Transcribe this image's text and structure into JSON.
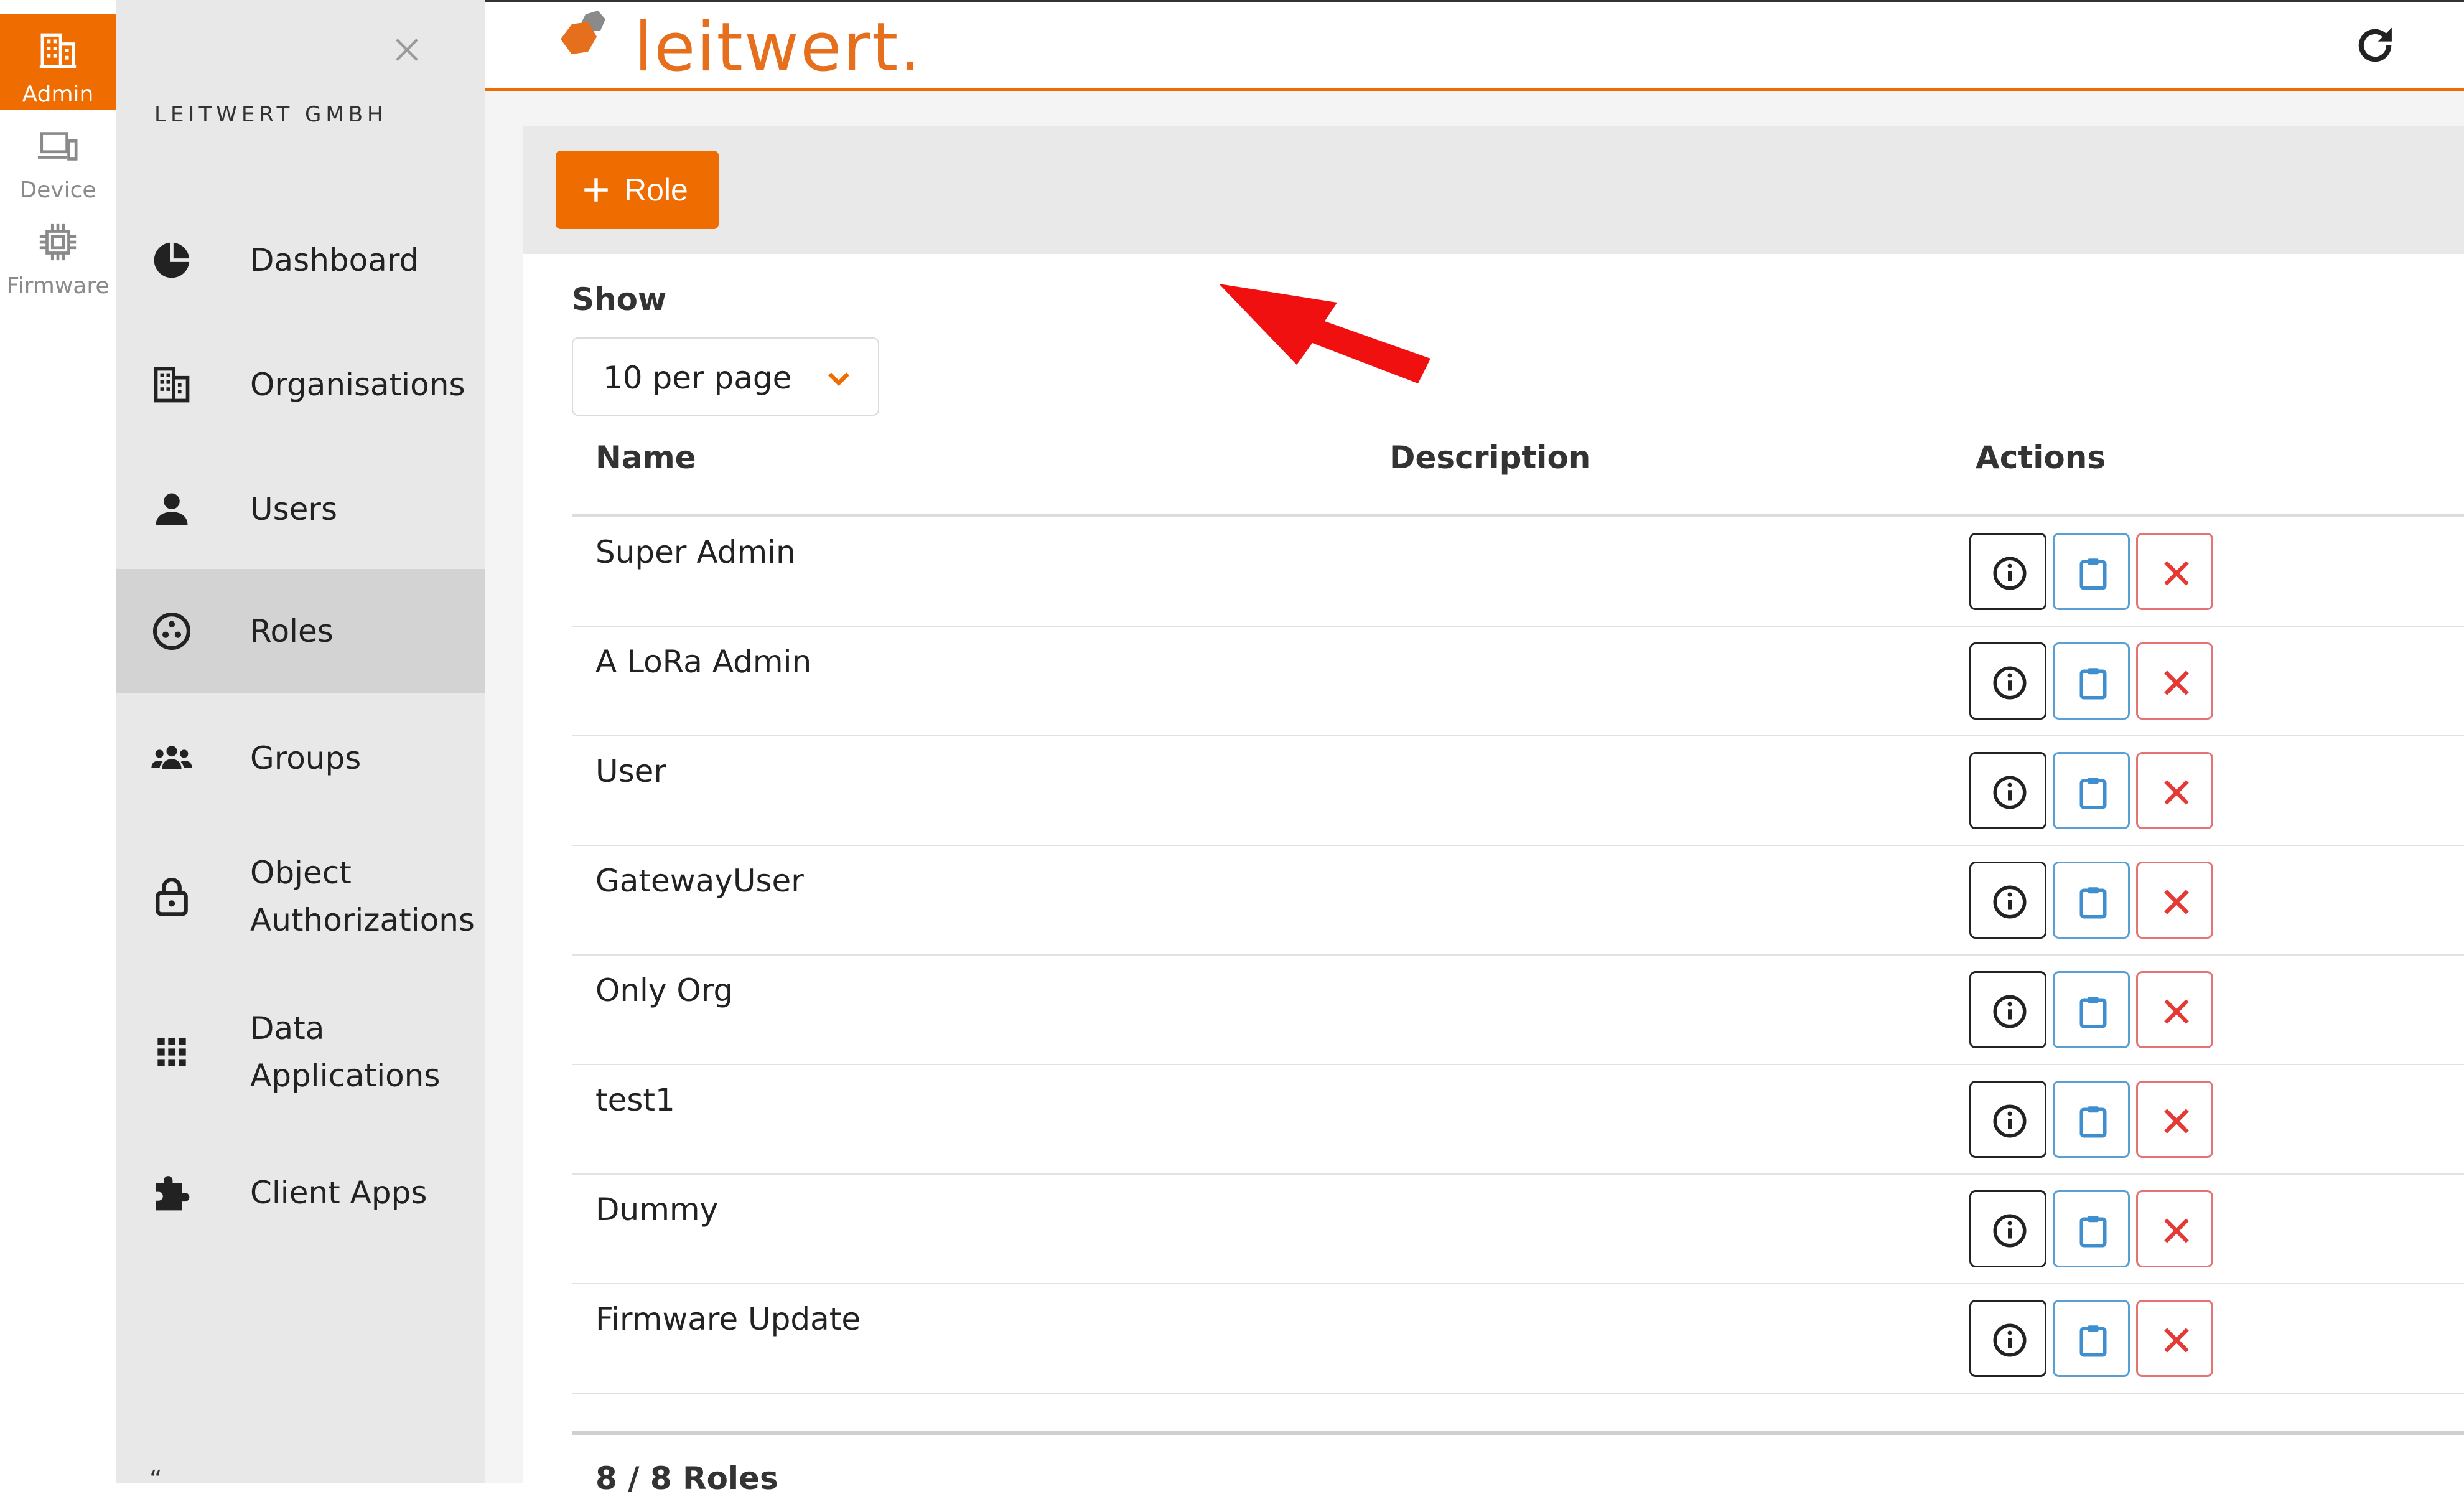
{
  "rail": {
    "items": [
      {
        "label": "Admin",
        "icon": "building-icon"
      },
      {
        "label": "Device",
        "icon": "devices-icon"
      },
      {
        "label": "Firmware",
        "icon": "chip-icon"
      }
    ]
  },
  "sidebar": {
    "org_name": "LEITWERT GMBH",
    "items": [
      {
        "label": "Dashboard",
        "icon": "pie-chart-icon"
      },
      {
        "label": "Organisations",
        "icon": "building-icon"
      },
      {
        "label": "Users",
        "icon": "user-icon"
      },
      {
        "label": "Roles",
        "icon": "roles-icon"
      },
      {
        "label": "Groups",
        "icon": "group-icon"
      },
      {
        "label": "Object Authorizations",
        "icon": "lock-icon"
      },
      {
        "label": "Data Applications",
        "icon": "grid-icon"
      },
      {
        "label": "Client Apps",
        "icon": "puzzle-icon"
      }
    ],
    "footer_glyph": "“"
  },
  "header": {
    "logo_text": "leitwert."
  },
  "toolbar": {
    "add_role_label": "Role"
  },
  "paging": {
    "show_label": "Show",
    "per_page_value": "10 per page"
  },
  "table": {
    "columns": [
      "Name",
      "Description",
      "Actions"
    ],
    "rows": [
      {
        "name": "Super Admin",
        "description": ""
      },
      {
        "name": "A LoRa Admin",
        "description": ""
      },
      {
        "name": "User",
        "description": ""
      },
      {
        "name": "GatewayUser",
        "description": ""
      },
      {
        "name": "Only Org",
        "description": ""
      },
      {
        "name": "test1",
        "description": ""
      },
      {
        "name": "Dummy",
        "description": ""
      },
      {
        "name": "Firmware Update",
        "description": ""
      }
    ],
    "count_text": "8 / 8 Roles"
  },
  "colors": {
    "accent": "#ef6c00",
    "sidebar_bg": "#e8e8e8",
    "sidebar_active": "#d3d3d3",
    "info_border": "#222222",
    "copy_border": "#5a9fd4",
    "delete_border": "#e57373",
    "delete_icon": "#e53935",
    "annotation_arrow": "#f01010"
  }
}
